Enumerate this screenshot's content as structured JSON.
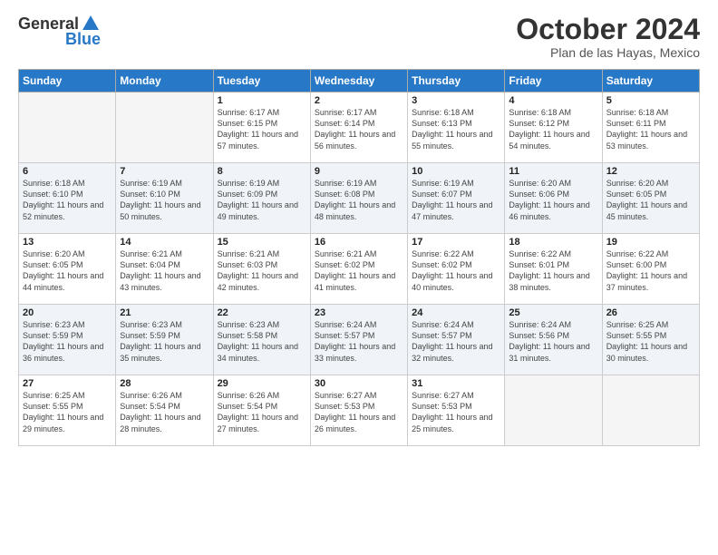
{
  "header": {
    "logo": {
      "general": "General",
      "blue": "Blue"
    },
    "title": "October 2024",
    "subtitle": "Plan de las Hayas, Mexico"
  },
  "weekdays": [
    "Sunday",
    "Monday",
    "Tuesday",
    "Wednesday",
    "Thursday",
    "Friday",
    "Saturday"
  ],
  "weeks": [
    [
      {
        "day": "",
        "empty": true
      },
      {
        "day": "",
        "empty": true
      },
      {
        "day": "1",
        "sunrise": "Sunrise: 6:17 AM",
        "sunset": "Sunset: 6:15 PM",
        "daylight": "Daylight: 11 hours and 57 minutes."
      },
      {
        "day": "2",
        "sunrise": "Sunrise: 6:17 AM",
        "sunset": "Sunset: 6:14 PM",
        "daylight": "Daylight: 11 hours and 56 minutes."
      },
      {
        "day": "3",
        "sunrise": "Sunrise: 6:18 AM",
        "sunset": "Sunset: 6:13 PM",
        "daylight": "Daylight: 11 hours and 55 minutes."
      },
      {
        "day": "4",
        "sunrise": "Sunrise: 6:18 AM",
        "sunset": "Sunset: 6:12 PM",
        "daylight": "Daylight: 11 hours and 54 minutes."
      },
      {
        "day": "5",
        "sunrise": "Sunrise: 6:18 AM",
        "sunset": "Sunset: 6:11 PM",
        "daylight": "Daylight: 11 hours and 53 minutes."
      }
    ],
    [
      {
        "day": "6",
        "sunrise": "Sunrise: 6:18 AM",
        "sunset": "Sunset: 6:10 PM",
        "daylight": "Daylight: 11 hours and 52 minutes."
      },
      {
        "day": "7",
        "sunrise": "Sunrise: 6:19 AM",
        "sunset": "Sunset: 6:10 PM",
        "daylight": "Daylight: 11 hours and 50 minutes."
      },
      {
        "day": "8",
        "sunrise": "Sunrise: 6:19 AM",
        "sunset": "Sunset: 6:09 PM",
        "daylight": "Daylight: 11 hours and 49 minutes."
      },
      {
        "day": "9",
        "sunrise": "Sunrise: 6:19 AM",
        "sunset": "Sunset: 6:08 PM",
        "daylight": "Daylight: 11 hours and 48 minutes."
      },
      {
        "day": "10",
        "sunrise": "Sunrise: 6:19 AM",
        "sunset": "Sunset: 6:07 PM",
        "daylight": "Daylight: 11 hours and 47 minutes."
      },
      {
        "day": "11",
        "sunrise": "Sunrise: 6:20 AM",
        "sunset": "Sunset: 6:06 PM",
        "daylight": "Daylight: 11 hours and 46 minutes."
      },
      {
        "day": "12",
        "sunrise": "Sunrise: 6:20 AM",
        "sunset": "Sunset: 6:05 PM",
        "daylight": "Daylight: 11 hours and 45 minutes."
      }
    ],
    [
      {
        "day": "13",
        "sunrise": "Sunrise: 6:20 AM",
        "sunset": "Sunset: 6:05 PM",
        "daylight": "Daylight: 11 hours and 44 minutes."
      },
      {
        "day": "14",
        "sunrise": "Sunrise: 6:21 AM",
        "sunset": "Sunset: 6:04 PM",
        "daylight": "Daylight: 11 hours and 43 minutes."
      },
      {
        "day": "15",
        "sunrise": "Sunrise: 6:21 AM",
        "sunset": "Sunset: 6:03 PM",
        "daylight": "Daylight: 11 hours and 42 minutes."
      },
      {
        "day": "16",
        "sunrise": "Sunrise: 6:21 AM",
        "sunset": "Sunset: 6:02 PM",
        "daylight": "Daylight: 11 hours and 41 minutes."
      },
      {
        "day": "17",
        "sunrise": "Sunrise: 6:22 AM",
        "sunset": "Sunset: 6:02 PM",
        "daylight": "Daylight: 11 hours and 40 minutes."
      },
      {
        "day": "18",
        "sunrise": "Sunrise: 6:22 AM",
        "sunset": "Sunset: 6:01 PM",
        "daylight": "Daylight: 11 hours and 38 minutes."
      },
      {
        "day": "19",
        "sunrise": "Sunrise: 6:22 AM",
        "sunset": "Sunset: 6:00 PM",
        "daylight": "Daylight: 11 hours and 37 minutes."
      }
    ],
    [
      {
        "day": "20",
        "sunrise": "Sunrise: 6:23 AM",
        "sunset": "Sunset: 5:59 PM",
        "daylight": "Daylight: 11 hours and 36 minutes."
      },
      {
        "day": "21",
        "sunrise": "Sunrise: 6:23 AM",
        "sunset": "Sunset: 5:59 PM",
        "daylight": "Daylight: 11 hours and 35 minutes."
      },
      {
        "day": "22",
        "sunrise": "Sunrise: 6:23 AM",
        "sunset": "Sunset: 5:58 PM",
        "daylight": "Daylight: 11 hours and 34 minutes."
      },
      {
        "day": "23",
        "sunrise": "Sunrise: 6:24 AM",
        "sunset": "Sunset: 5:57 PM",
        "daylight": "Daylight: 11 hours and 33 minutes."
      },
      {
        "day": "24",
        "sunrise": "Sunrise: 6:24 AM",
        "sunset": "Sunset: 5:57 PM",
        "daylight": "Daylight: 11 hours and 32 minutes."
      },
      {
        "day": "25",
        "sunrise": "Sunrise: 6:24 AM",
        "sunset": "Sunset: 5:56 PM",
        "daylight": "Daylight: 11 hours and 31 minutes."
      },
      {
        "day": "26",
        "sunrise": "Sunrise: 6:25 AM",
        "sunset": "Sunset: 5:55 PM",
        "daylight": "Daylight: 11 hours and 30 minutes."
      }
    ],
    [
      {
        "day": "27",
        "sunrise": "Sunrise: 6:25 AM",
        "sunset": "Sunset: 5:55 PM",
        "daylight": "Daylight: 11 hours and 29 minutes."
      },
      {
        "day": "28",
        "sunrise": "Sunrise: 6:26 AM",
        "sunset": "Sunset: 5:54 PM",
        "daylight": "Daylight: 11 hours and 28 minutes."
      },
      {
        "day": "29",
        "sunrise": "Sunrise: 6:26 AM",
        "sunset": "Sunset: 5:54 PM",
        "daylight": "Daylight: 11 hours and 27 minutes."
      },
      {
        "day": "30",
        "sunrise": "Sunrise: 6:27 AM",
        "sunset": "Sunset: 5:53 PM",
        "daylight": "Daylight: 11 hours and 26 minutes."
      },
      {
        "day": "31",
        "sunrise": "Sunrise: 6:27 AM",
        "sunset": "Sunset: 5:53 PM",
        "daylight": "Daylight: 11 hours and 25 minutes."
      },
      {
        "day": "",
        "empty": true
      },
      {
        "day": "",
        "empty": true
      }
    ]
  ]
}
